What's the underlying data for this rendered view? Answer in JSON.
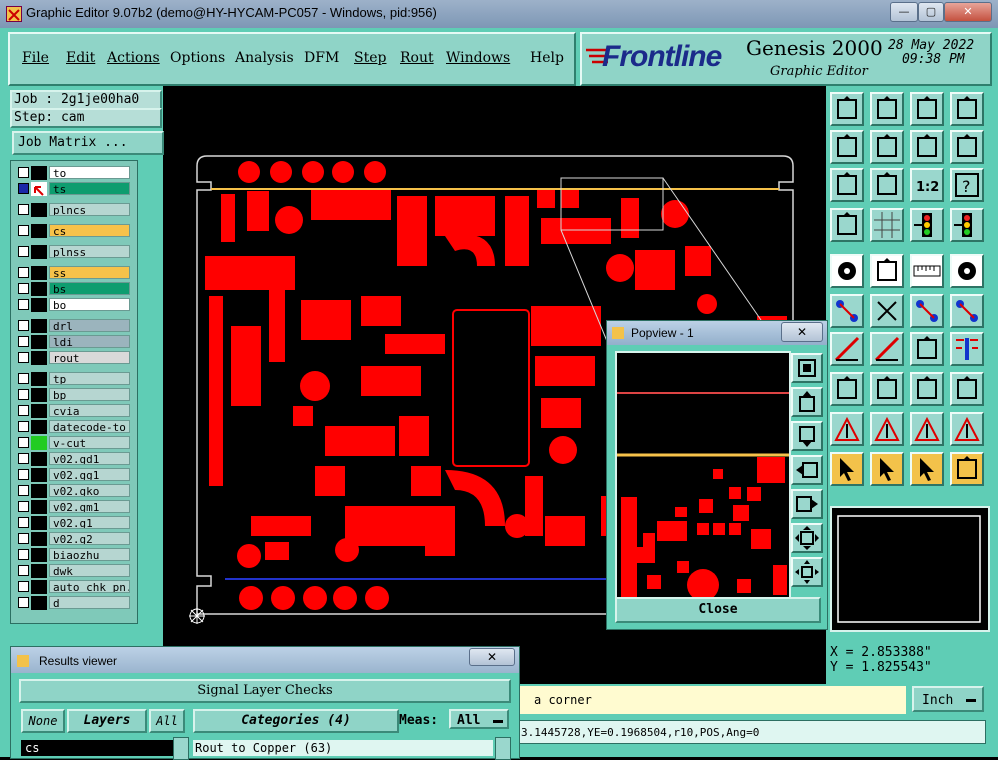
{
  "window": {
    "title": "Graphic Editor 9.07b2 (demo@HY-HYCAM-PC057 - Windows, pid:956)"
  },
  "menu": [
    "File",
    "Edit",
    "Actions",
    "Options",
    "Analysis",
    "DFM",
    "Step",
    "Rout",
    "Windows",
    "Help"
  ],
  "brand": {
    "logo": "Frontline",
    "product": "Genesis 2000",
    "subtitle": "Graphic Editor",
    "date": "28 May 2022",
    "time": "09:38 PM"
  },
  "job": {
    "label": "Job : 2g1je00ha0",
    "step": "Step: cam",
    "matrix_button": "Job Matrix ..."
  },
  "layers": [
    {
      "name": "to",
      "color": "#ffffff"
    },
    {
      "name": "ts",
      "color": "#0e9d6f"
    },
    {
      "name": "plncs",
      "color": "#b6d6d1"
    },
    {
      "name": "cs",
      "color": "#f6c24a"
    },
    {
      "name": "plnss",
      "color": "#b6d6d1"
    },
    {
      "name": "ss",
      "color": "#f6c24a"
    },
    {
      "name": "bs",
      "color": "#0e9d6f"
    },
    {
      "name": "bo",
      "color": "#ffffff"
    },
    {
      "name": "drl",
      "color": "#9bb4bd"
    },
    {
      "name": "ldi",
      "color": "#9bb4bd"
    },
    {
      "name": "rout",
      "color": "#d9d9d9"
    },
    {
      "name": "tp",
      "color": "#b6d6d1"
    },
    {
      "name": "bp",
      "color": "#b6d6d1"
    },
    {
      "name": "cvia",
      "color": "#b6d6d1"
    },
    {
      "name": "datecode-to",
      "color": "#b6d6d1"
    },
    {
      "name": "v-cut",
      "color": "#b6d6d1"
    },
    {
      "name": "v02.gd1",
      "color": "#b6d6d1"
    },
    {
      "name": "v02.gg1",
      "color": "#b6d6d1"
    },
    {
      "name": "v02.gko",
      "color": "#b6d6d1"
    },
    {
      "name": "v02.gm1",
      "color": "#b6d6d1"
    },
    {
      "name": "v02.g1",
      "color": "#b6d6d1"
    },
    {
      "name": "v02.g2",
      "color": "#b6d6d1"
    },
    {
      "name": "biaozhu",
      "color": "#b6d6d1"
    },
    {
      "name": "dwk",
      "color": "#b6d6d1"
    },
    {
      "name": "auto_chk_pn.",
      "color": "#b6d6d1"
    },
    {
      "name": "d",
      "color": "#b6d6d1"
    }
  ],
  "popview": {
    "title": "Popview - 1",
    "close_label": "Close"
  },
  "coords": {
    "x": "X = 2.853388\"",
    "y": "Y = 1.825543\""
  },
  "units": "Inch",
  "status": {
    "message": "a corner",
    "feature": "3.1445728,YE=0.1968504,r10,POS,Ang=0"
  },
  "results": {
    "title": "Results viewer",
    "header": "Signal Layer Checks",
    "none_btn": "None",
    "layers_btn": "Layers",
    "all_btn": "All",
    "categories_btn": "Categories (4)",
    "meas_label": "Meas:",
    "meas_value": "All",
    "layer_item": "cs",
    "category_item": "Rout to Copper (63)"
  },
  "colors": {
    "copper": "#ff0000",
    "panel": "#5fcdb5",
    "outline": "#d8d8d8"
  }
}
